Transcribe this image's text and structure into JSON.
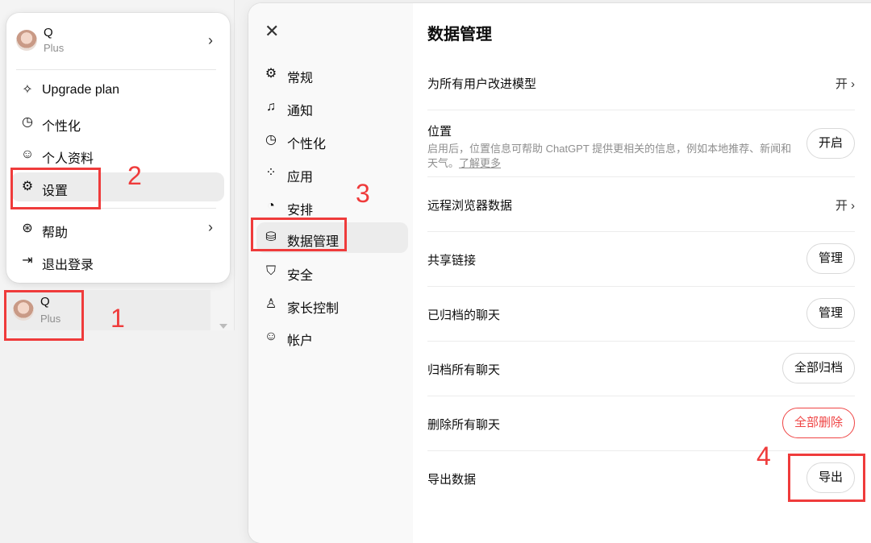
{
  "account_popup": {
    "user_name": "Q",
    "user_plan": "Plus",
    "items": [
      {
        "label": "Upgrade plan",
        "icon": "sparkle-icon"
      },
      {
        "label": "个性化",
        "icon": "personalize-icon"
      },
      {
        "label": "个人资料",
        "icon": "profile-icon"
      },
      {
        "label": "设置",
        "icon": "gear-icon"
      },
      {
        "label": "帮助",
        "icon": "help-icon"
      },
      {
        "label": "退出登录",
        "icon": "logout-icon"
      }
    ]
  },
  "sidebar_user": {
    "name": "Q",
    "plan": "Plus"
  },
  "settings_nav": [
    {
      "label": "常规",
      "icon": "gear-icon"
    },
    {
      "label": "通知",
      "icon": "bell-icon"
    },
    {
      "label": "个性化",
      "icon": "personalize-icon"
    },
    {
      "label": "应用",
      "icon": "apps-icon"
    },
    {
      "label": "安排",
      "icon": "clock-icon"
    },
    {
      "label": "数据管理",
      "icon": "database-icon"
    },
    {
      "label": "安全",
      "icon": "shield-icon"
    },
    {
      "label": "家长控制",
      "icon": "parental-icon"
    },
    {
      "label": "帐户",
      "icon": "account-icon"
    }
  ],
  "data_controls": {
    "title": "数据管理",
    "rows": [
      {
        "label": "为所有用户改进模型",
        "value": "开"
      },
      {
        "label": "位置",
        "description": "启用后，位置信息可帮助 ChatGPT 提供更相关的信息，例如本地推荐、新闻和天气。",
        "link": "了解更多",
        "button": "开启"
      },
      {
        "label": "远程浏览器数据",
        "value": "开"
      },
      {
        "label": "共享链接",
        "button": "管理"
      },
      {
        "label": "已归档的聊天",
        "button": "管理"
      },
      {
        "label": "归档所有聊天",
        "button": "全部归档"
      },
      {
        "label": "删除所有聊天",
        "button": "全部删除"
      },
      {
        "label": "导出数据",
        "button": "导出"
      }
    ]
  },
  "annotations": [
    "1",
    "2",
    "3",
    "4"
  ],
  "colors": {
    "annotation": "#ef3b3b",
    "danger": "#ef4444",
    "muted": "#8e8e8e"
  }
}
